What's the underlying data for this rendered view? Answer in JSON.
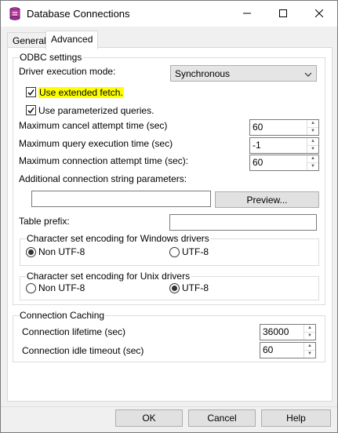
{
  "window": {
    "title": "Database Connections",
    "controls": {
      "minimize": "minimize-icon",
      "maximize": "maximize-icon",
      "close": "close-icon"
    }
  },
  "tabs": [
    {
      "label": "General",
      "active": false
    },
    {
      "label": "Advanced",
      "active": true
    }
  ],
  "odbc": {
    "group_label": "ODBC settings",
    "driver_mode_label": "Driver execution mode:",
    "driver_mode_value": "Synchronous",
    "use_extended_fetch": {
      "label": "Use extended fetch.",
      "checked": true,
      "highlight_color": "#ffff00"
    },
    "use_parameterized": {
      "label": "Use parameterized queries.",
      "checked": true
    },
    "max_cancel": {
      "label": "Maximum cancel attempt time (sec)",
      "value": "60"
    },
    "max_query": {
      "label": "Maximum query execution time (sec)",
      "value": "-1"
    },
    "max_connection": {
      "label": "Maximum connection attempt time (sec):",
      "value": "60"
    },
    "additional_params": {
      "label": "Additional connection string parameters:",
      "value": ""
    },
    "preview_button": "Preview...",
    "table_prefix": {
      "label": "Table prefix:",
      "value": ""
    },
    "windows_encoding": {
      "label": "Character set encoding for Windows drivers",
      "options": [
        {
          "label": "Non UTF-8",
          "selected": true
        },
        {
          "label": "UTF-8",
          "selected": false
        }
      ]
    },
    "unix_encoding": {
      "label": "Character set encoding for Unix drivers",
      "options": [
        {
          "label": "Non UTF-8",
          "selected": false
        },
        {
          "label": "UTF-8",
          "selected": true
        }
      ]
    }
  },
  "caching": {
    "group_label": "Connection Caching",
    "lifetime": {
      "label": "Connection lifetime (sec)",
      "value": "36000"
    },
    "idle_timeout": {
      "label": "Connection idle timeout (sec)",
      "value": "60"
    }
  },
  "footer": {
    "ok": "OK",
    "cancel": "Cancel",
    "help": "Help"
  }
}
